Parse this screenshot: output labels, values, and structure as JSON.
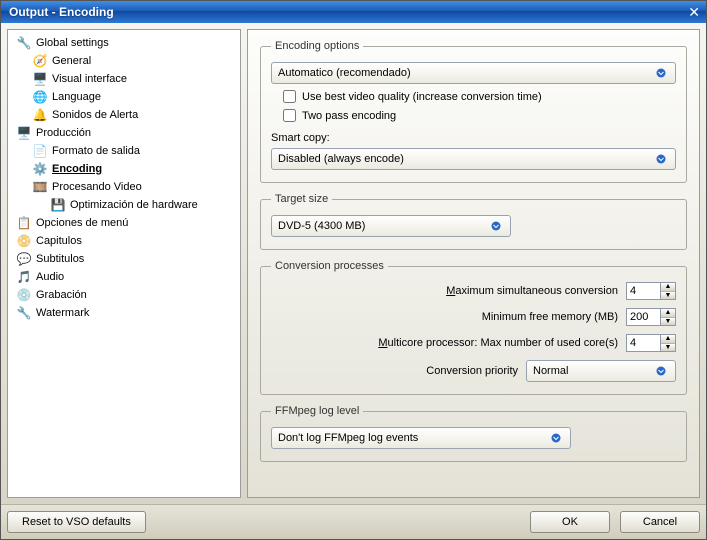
{
  "window": {
    "title": "Output - Encoding"
  },
  "sidebar": {
    "items": [
      {
        "label": "Global settings",
        "icon": "🔧",
        "depth": 0
      },
      {
        "label": "General",
        "icon": "🧭",
        "depth": 1
      },
      {
        "label": "Visual interface",
        "icon": "🖥️",
        "depth": 1
      },
      {
        "label": "Language",
        "icon": "🌐",
        "depth": 1
      },
      {
        "label": "Sonidos de Alerta",
        "icon": "🔔",
        "depth": 1
      },
      {
        "label": "Producción",
        "icon": "🖥️",
        "depth": 0
      },
      {
        "label": "Formato de salida",
        "icon": "📄",
        "depth": 1
      },
      {
        "label": "Encoding",
        "icon": "⚙️",
        "depth": 1,
        "selected": true
      },
      {
        "label": "Procesando Video",
        "icon": "🎞️",
        "depth": 1
      },
      {
        "label": "Optimización de hardware",
        "icon": "💾",
        "depth": 2
      },
      {
        "label": "Opciones de menú",
        "icon": "📋",
        "depth": 0
      },
      {
        "label": "Capitulos",
        "icon": "📀",
        "depth": 0
      },
      {
        "label": "Subtitulos",
        "icon": "💬",
        "depth": 0
      },
      {
        "label": "Audio",
        "icon": "🎵",
        "depth": 0
      },
      {
        "label": "Grabación",
        "icon": "💿",
        "depth": 0
      },
      {
        "label": "Watermark",
        "icon": "🔧",
        "depth": 0
      }
    ]
  },
  "encoding": {
    "legend": "Encoding options",
    "mode": "Automatico (recomendado)",
    "best_quality": {
      "checked": false,
      "label": "Use best video quality (increase conversion time)"
    },
    "two_pass": {
      "checked": false,
      "label": "Two pass encoding"
    },
    "smartcopy_label": "Smart copy:",
    "smartcopy_value": "Disabled (always encode)"
  },
  "target": {
    "legend": "Target size",
    "value": "DVD-5 (4300 MB)"
  },
  "procs": {
    "legend": "Conversion processes",
    "max_conv": {
      "label": "Maximum simultaneous conversion",
      "value": "4",
      "underline_first": "M"
    },
    "min_mem": {
      "label": "Minimum free memory (MB)",
      "value": "200"
    },
    "cores": {
      "label": "Multicore processor: Max number of used core(s)",
      "value": "4",
      "underline_first": "M"
    },
    "priority_label": "Conversion priority",
    "priority_value": "Normal"
  },
  "ffmpeg": {
    "legend": "FFMpeg log level",
    "value": "Don't log FFMpeg log events"
  },
  "footer": {
    "reset": "Reset to VSO defaults",
    "ok": "OK",
    "cancel": "Cancel"
  }
}
